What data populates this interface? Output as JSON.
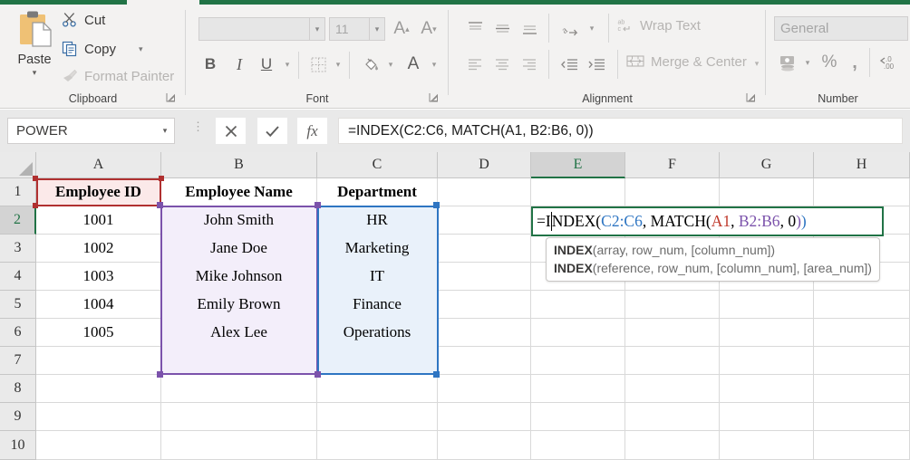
{
  "app": {
    "accent_green": "#217346"
  },
  "ribbon": {
    "groups": [
      {
        "label": "Clipboard"
      },
      {
        "label": "Font"
      },
      {
        "label": "Alignment"
      },
      {
        "label": "Number"
      }
    ],
    "clipboard": {
      "paste_label": "Paste",
      "cut_label": "Cut",
      "copy_label": "Copy",
      "format_painter_label": "Format Painter"
    },
    "font": {
      "font_name_value": "",
      "font_name_placeholder": "",
      "font_size_value": "11",
      "grow_font_label": "A",
      "shrink_font_label": "A",
      "bold_label": "B",
      "italic_label": "I",
      "underline_label": "U",
      "font_color_label": "A"
    },
    "alignment": {
      "wrap_text_label": "Wrap Text",
      "merge_center_label": "Merge & Center"
    },
    "number": {
      "format_value": "General",
      "percent_label": "%",
      "comma_label": ",",
      "decrease_decimal_label": ".00"
    }
  },
  "formula_bar": {
    "name_box_value": "POWER",
    "cancel_label": "✕",
    "enter_label": "✓",
    "insert_function_label": "fx",
    "formula_value": "=INDEX(C2:C6, MATCH(A1, B2:B6, 0))"
  },
  "sheet": {
    "column_headers": [
      "A",
      "B",
      "C",
      "D",
      "E",
      "F",
      "G",
      "H"
    ],
    "row_headers": [
      "1",
      "2",
      "3",
      "4",
      "5",
      "6",
      "7",
      "8",
      "9",
      "10"
    ],
    "active_column": "E",
    "active_row": "2",
    "cells": {
      "A1": "Employee ID",
      "B1": "Employee Name",
      "C1": "Department",
      "A2": "1001",
      "B2": "John Smith",
      "C2": "HR",
      "A3": "1002",
      "B3": "Jane Doe",
      "C3": "Marketing",
      "A4": "1003",
      "B4": "Mike Johnson",
      "C4": "IT",
      "A5": "1004",
      "B5": "Emily Brown",
      "C5": "Finance",
      "A6": "1005",
      "B6": "Alex Lee",
      "C6": "Operations"
    },
    "reference_highlights": [
      {
        "range": "A1",
        "color": "#b03030",
        "fill": "#fbe9e9"
      },
      {
        "range": "B2:B6",
        "color": "#7b52ab",
        "fill": "#f3eefa"
      },
      {
        "range": "C2:C6",
        "color": "#2e75c2",
        "fill": "#e9f1fa"
      }
    ]
  },
  "editing_cell": {
    "address": "E2",
    "prefix": "=I",
    "segments": [
      {
        "text": "NDEX(",
        "color": "#000000"
      },
      {
        "text": "C2:C6",
        "color": "#2e75c2"
      },
      {
        "text": ", MATCH(",
        "color": "#000000"
      },
      {
        "text": "A1",
        "color": "#c0392b"
      },
      {
        "text": ", ",
        "color": "#000000"
      },
      {
        "text": "B2:B6",
        "color": "#7b52ab"
      },
      {
        "text": ", 0",
        "color": "#000000"
      },
      {
        "text": ")",
        "color": "#7b52ab"
      },
      {
        "text": ")",
        "color": "#2e75c2"
      }
    ]
  },
  "tooltip": {
    "line1_fn": "INDEX",
    "line1_args": "(array, row_num, [column_num])",
    "line2_fn": "INDEX",
    "line2_args": "(reference, row_num, [column_num], [area_num])"
  }
}
